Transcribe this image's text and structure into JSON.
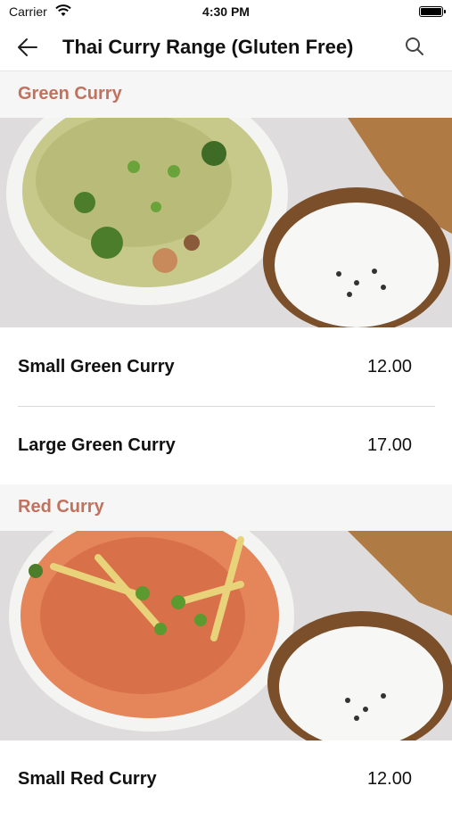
{
  "status_bar": {
    "carrier": "Carrier",
    "time": "4:30 PM"
  },
  "nav": {
    "title": "Thai Curry Range (Gluten Free)"
  },
  "sections": [
    {
      "title": "Green Curry",
      "items": [
        {
          "name": "Small Green Curry",
          "price": "12.00"
        },
        {
          "name": "Large Green Curry",
          "price": "17.00"
        }
      ]
    },
    {
      "title": "Red Curry",
      "items": [
        {
          "name": "Small Red Curry",
          "price": "12.00"
        }
      ]
    }
  ],
  "colors": {
    "section_title": "#c0725f",
    "section_bg": "#f6f6f6"
  },
  "icons": [
    "wifi-icon",
    "battery-icon",
    "back-arrow-icon",
    "search-icon"
  ]
}
